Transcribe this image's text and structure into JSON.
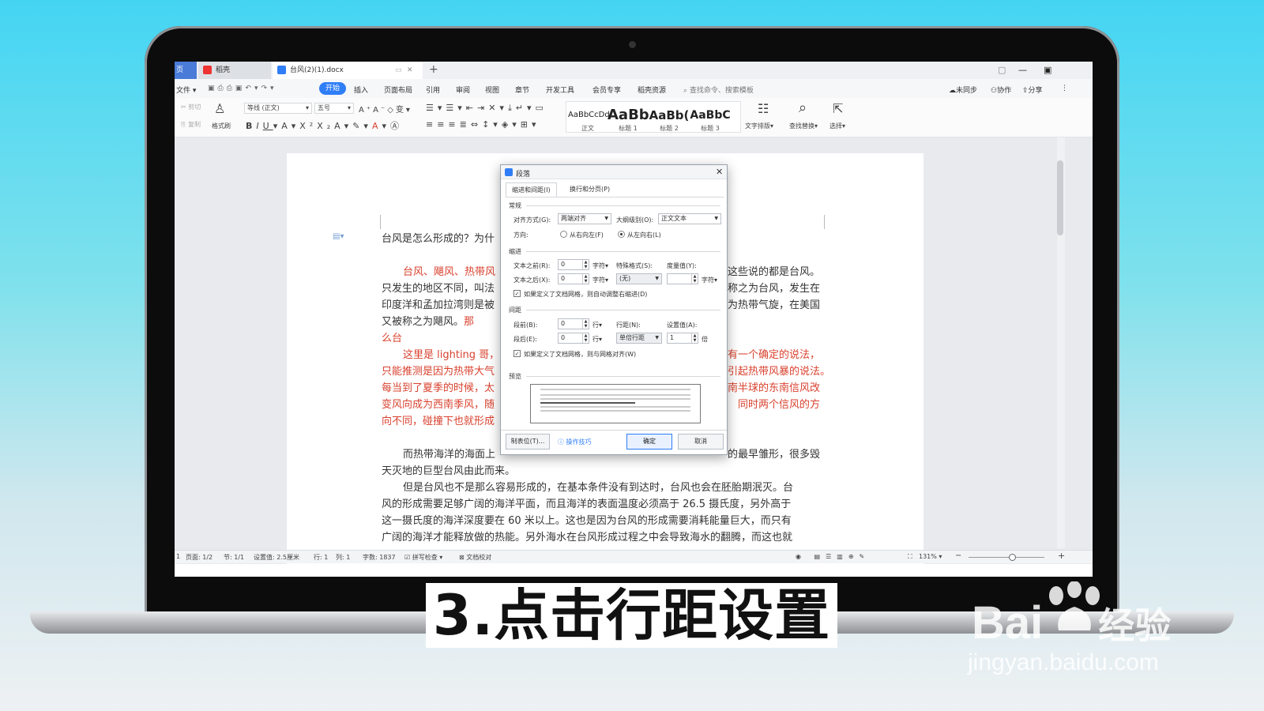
{
  "tabs": {
    "home": "页",
    "wps": "稻壳",
    "doc": "台风(2)(1).docx"
  },
  "menu": {
    "file": "文件",
    "items": [
      "开始",
      "插入",
      "页面布局",
      "引用",
      "审阅",
      "视图",
      "章节",
      "开发工具",
      "会员专享",
      "稻壳资源"
    ],
    "search": "查找命令、搜索模板",
    "right": [
      "未同步",
      "协作",
      "分享"
    ]
  },
  "ribbon": {
    "cut": "剪切",
    "copy": "复制",
    "format_painter": "格式刷",
    "font": "等线 (正文)",
    "size": "五号",
    "styles": [
      {
        "sample": "AaBbCcDd",
        "label": "正文"
      },
      {
        "sample": "AaBb",
        "label": "标题 1"
      },
      {
        "sample": "AaBb(",
        "label": "标题 2"
      },
      {
        "sample": "AaBbC",
        "label": "标题 3"
      }
    ],
    "text_layout": "文字排版",
    "find_replace": "查找替换",
    "select": "选择"
  },
  "doc": {
    "p1": "台风是怎么形成的？为什",
    "p2a": "台风、飓风、热带风",
    "p2b": "这些说的都是台风。",
    "p3a": "只发生的地区不同，叫法",
    "p3b": "称之为台风，发生在",
    "p4a": "印度洋和孟加拉湾则是被",
    "p4b": "为热带气旋，在美国",
    "p5a": "又被称之为飓风。",
    "p5red": "那么台",
    "p6a": "这里是 lighting 哥，",
    "p6b": "有一个确定的说法，",
    "p7a": "只能推测是因为热带大气",
    "p7b": "引起热带风暴的说法。",
    "p8a": "每当到了夏季的时候，太",
    "p8b": "南半球的东南信风改",
    "p9a": "变风向成为西南季风，随",
    "p9b": "同时两个信风的方",
    "p10a": "向不同，碰撞下也就形成",
    "p11a": "而热带海洋的海面上",
    "p11b": "的最早雏形，很多毁",
    "p12": "天灭地的巨型台风由此而来。",
    "p13": "但是台风也不是那么容易形成的，在基本条件没有到达时，台风也会在胚胎期泯灭。台",
    "p14": "风的形成需要足够广阔的海洋平面，而且海洋的表面温度必须高于 26.5 摄氏度，另外高于",
    "p15": "这一摄氏度的海洋深度要在 60 米以上。这也是因为台风的形成需要消耗能量巨大，而只有",
    "p16": "广阔的海洋才能释放做的热能。另外海水在台风形成过程之中会导致海水的翻腾，而这也就"
  },
  "status": {
    "page": "页面: 1/2",
    "section": "节: 1/1",
    "setting": "设置值: 2.5厘米",
    "row": "行: 1",
    "col": "列: 1",
    "words": "字数: 1837",
    "spell": "拼写检查",
    "proof": "文档校对",
    "zoom": "131%"
  },
  "dialog": {
    "title": "段落",
    "tab1": "缩进和间距(I)",
    "tab2": "换行和分页(P)",
    "general": "常规",
    "align_label": "对齐方式(G):",
    "align_value": "两端对齐",
    "outline_label": "大纲级别(O):",
    "outline_value": "正文文本",
    "direction_label": "方向:",
    "rtl": "从右向左(F)",
    "ltr": "从左向右(L)",
    "indent": "缩进",
    "before_text_label": "文本之前(R):",
    "before_text_value": "0",
    "unit_char": "字符",
    "special_label": "特殊格式(S):",
    "special_value": "(无)",
    "measure_label": "度量值(Y):",
    "after_text_label": "文本之后(X):",
    "after_text_value": "0",
    "auto_indent": "如果定义了文档网格，则自动调整右缩进(D)",
    "spacing": "间距",
    "before_label": "段前(B):",
    "before_value": "0",
    "unit_line": "行",
    "line_spacing_label": "行距(N):",
    "line_spacing_value": "单倍行距",
    "set_value_label": "设置值(A):",
    "set_value": "1",
    "unit_times": "倍",
    "after_label": "段后(E):",
    "after_value": "0",
    "grid_align": "如果定义了文档网格，则与网格对齐(W)",
    "preview": "预览",
    "tabs_btn": "制表位(T)...",
    "tips": "操作技巧",
    "ok": "确定",
    "cancel": "取消"
  },
  "caption": "3.点击行距设置",
  "watermark": {
    "brand": "Bai",
    "brand_cn": "经验",
    "url": "jingyan.baidu.com"
  },
  "colors": {
    "accent": "#2f7ef7",
    "red_text": "#d9422f",
    "bg_cyan": "#44d5f3"
  }
}
